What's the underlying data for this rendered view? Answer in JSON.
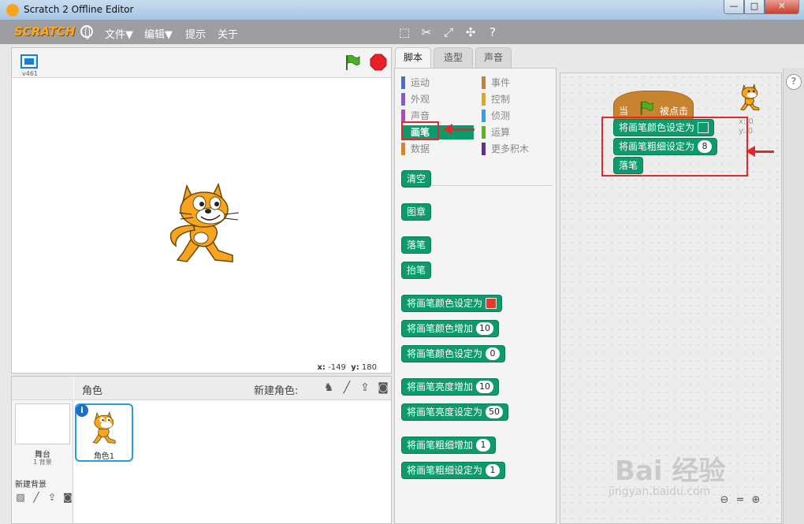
{
  "window": {
    "title": "Scratch 2 Offline Editor",
    "buttons": {
      "minimize": "—",
      "maximize": "□",
      "close": "✕"
    }
  },
  "menubar": {
    "logo": "SCRATCH",
    "items": [
      "文件▼",
      "编辑▼",
      "提示",
      "关于"
    ],
    "tools": [
      "duplicate-icon",
      "cut-icon",
      "grow-icon",
      "shrink-icon",
      "help-icon"
    ]
  },
  "stage": {
    "version": "v461",
    "coords": {
      "x_label": "x:",
      "x_value": "-149",
      "y_label": "y:",
      "y_value": "180"
    }
  },
  "sprites": {
    "title": "角色",
    "new_sprite_label": "新建角色:",
    "stage_label": "舞台",
    "backdrop_count": "1 背景",
    "new_backdrop_label": "新建背景",
    "sprite_name": "角色1",
    "info": "i"
  },
  "tabs": [
    "脚本",
    "造型",
    "声音"
  ],
  "categories": [
    {
      "label": "运动",
      "color": "#4a6cd4"
    },
    {
      "label": "事件",
      "color": "#c88330"
    },
    {
      "label": "外观",
      "color": "#8a55d7"
    },
    {
      "label": "控制",
      "color": "#e1a91a"
    },
    {
      "label": "声音",
      "color": "#bb42c3"
    },
    {
      "label": "侦测",
      "color": "#2ca5e2"
    },
    {
      "label": "画笔",
      "color": "#0e9a6c"
    },
    {
      "label": "运算",
      "color": "#5cb712"
    },
    {
      "label": "数据",
      "color": "#ee7d16"
    },
    {
      "label": "更多积木",
      "color": "#632d99"
    }
  ],
  "palette_blocks": [
    {
      "text": "清空"
    },
    {
      "text": "图章"
    },
    {
      "text": "落笔"
    },
    {
      "text": "抬笔"
    },
    {
      "text": "将画笔颜色设定为",
      "swatch": "#e53b2f"
    },
    {
      "text": "将画笔颜色增加",
      "value": "10"
    },
    {
      "text": "将画笔颜色设定为",
      "value": "0"
    },
    {
      "text": "将画笔亮度增加",
      "value": "10"
    },
    {
      "text": "将画笔亮度设定为",
      "value": "50"
    },
    {
      "text": "将画笔粗细增加",
      "value": "1"
    },
    {
      "text": "将画笔粗细设定为",
      "value": "1"
    }
  ],
  "script": {
    "hat_when": "当",
    "hat_clicked": "被点击",
    "blocks": [
      {
        "text": "将画笔颜色设定为",
        "swatch": "#0e9a6c"
      },
      {
        "text": "将画笔粗细设定为",
        "value": "8"
      },
      {
        "text": "落笔"
      }
    ],
    "thumb_x": "x: 0",
    "thumb_y": "y: 0"
  },
  "watermark": {
    "brand": "Bai 经验",
    "url": "jingyan.baidu.com"
  },
  "colors": {
    "pen": "#0e9a6c",
    "menubar": "#9c9ea2",
    "annotation": "#e0282d",
    "hat": "#c88330"
  }
}
